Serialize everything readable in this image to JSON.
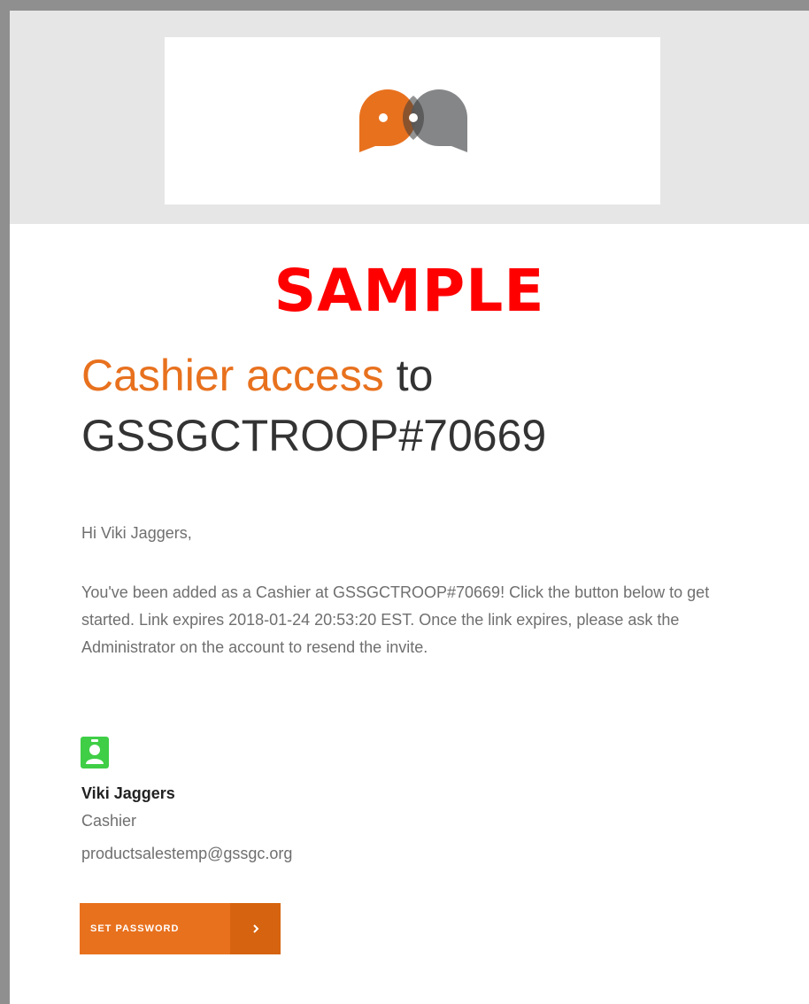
{
  "watermark": "SAMPLE",
  "headline": {
    "accent": "Cashier access",
    "connector": "to",
    "account": "GSSGCTROOP#70669"
  },
  "greeting": "Hi Viki Jaggers,",
  "message": "You've been added as a Cashier at GSSGCTROOP#70669! Click the button below to get started. Link expires 2018-01-24 20:53:20 EST. Once the link expires, please ask the Administrator on the account to resend the invite.",
  "user": {
    "icon": "user-badge-icon",
    "name": "Viki Jaggers",
    "role": "Cashier",
    "email": "productsalestemp@gssgc.org"
  },
  "cta": {
    "label": "SET PASSWORD",
    "icon": "chevron-right-icon"
  },
  "colors": {
    "accent": "#e8711e",
    "watermark": "#ff0000",
    "logo_gray": "#7b7c7e",
    "user_icon": "#3fce46"
  }
}
